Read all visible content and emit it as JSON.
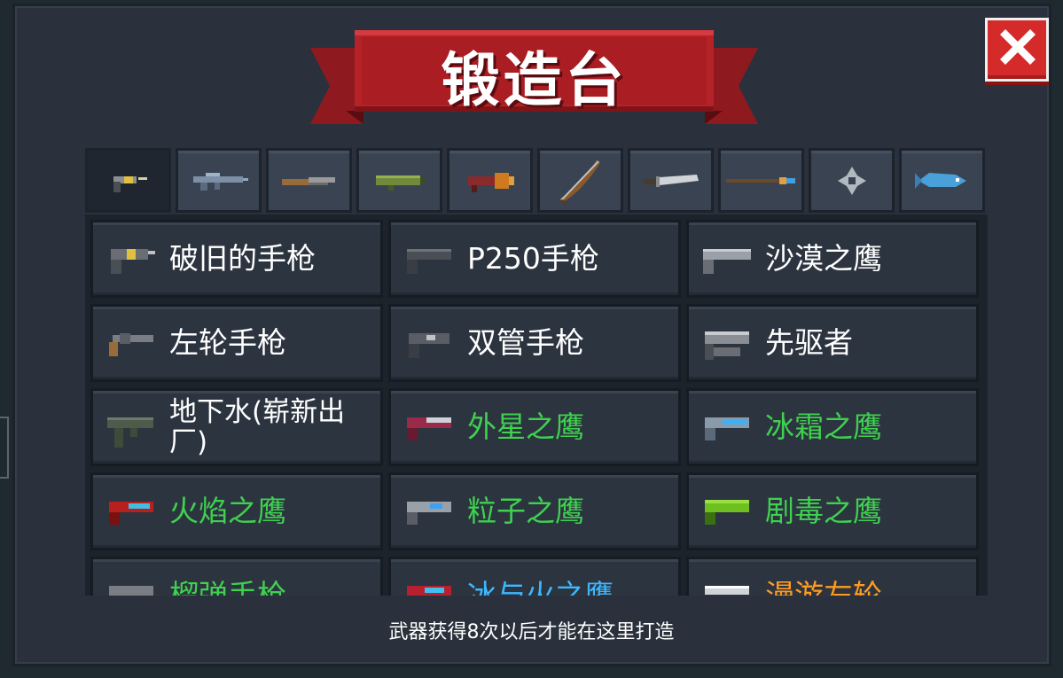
{
  "header": {
    "title": "锻造台"
  },
  "close_button": {
    "icon": "close-icon",
    "color": "#d42a2a"
  },
  "tabs": [
    {
      "name": "pistol",
      "icon": "pistol-icon",
      "active": true
    },
    {
      "name": "rifle",
      "icon": "rifle-icon",
      "active": false
    },
    {
      "name": "shotgun",
      "icon": "shotgun-icon",
      "active": false
    },
    {
      "name": "launcher",
      "icon": "launcher-icon",
      "active": false
    },
    {
      "name": "rocket",
      "icon": "rocket-icon",
      "active": false
    },
    {
      "name": "bow",
      "icon": "bow-icon",
      "active": false
    },
    {
      "name": "sword",
      "icon": "sword-icon",
      "active": false
    },
    {
      "name": "staff",
      "icon": "staff-icon",
      "active": false
    },
    {
      "name": "throwing",
      "icon": "shuriken-icon",
      "active": false
    },
    {
      "name": "fish",
      "icon": "fish-icon",
      "active": false
    }
  ],
  "weapons": [
    {
      "name": "破旧的手枪",
      "color": "white"
    },
    {
      "name": "P250手枪",
      "color": "white"
    },
    {
      "name": "沙漠之鹰",
      "color": "white"
    },
    {
      "name": "左轮手枪",
      "color": "white"
    },
    {
      "name": "双管手枪",
      "color": "white"
    },
    {
      "name": "先驱者",
      "color": "white"
    },
    {
      "name": "地下水(崭新出厂)",
      "color": "white"
    },
    {
      "name": "外星之鹰",
      "color": "green"
    },
    {
      "name": "冰霜之鹰",
      "color": "green"
    },
    {
      "name": "火焰之鹰",
      "color": "green"
    },
    {
      "name": "粒子之鹰",
      "color": "green"
    },
    {
      "name": "剧毒之鹰",
      "color": "green"
    },
    {
      "name": "榴弹手枪",
      "color": "green"
    },
    {
      "name": "冰与火之鹰",
      "color": "blue"
    },
    {
      "name": "漫游左轮",
      "color": "orange"
    }
  ],
  "footer": {
    "hint": "武器获得8次以后才能在这里打造"
  }
}
